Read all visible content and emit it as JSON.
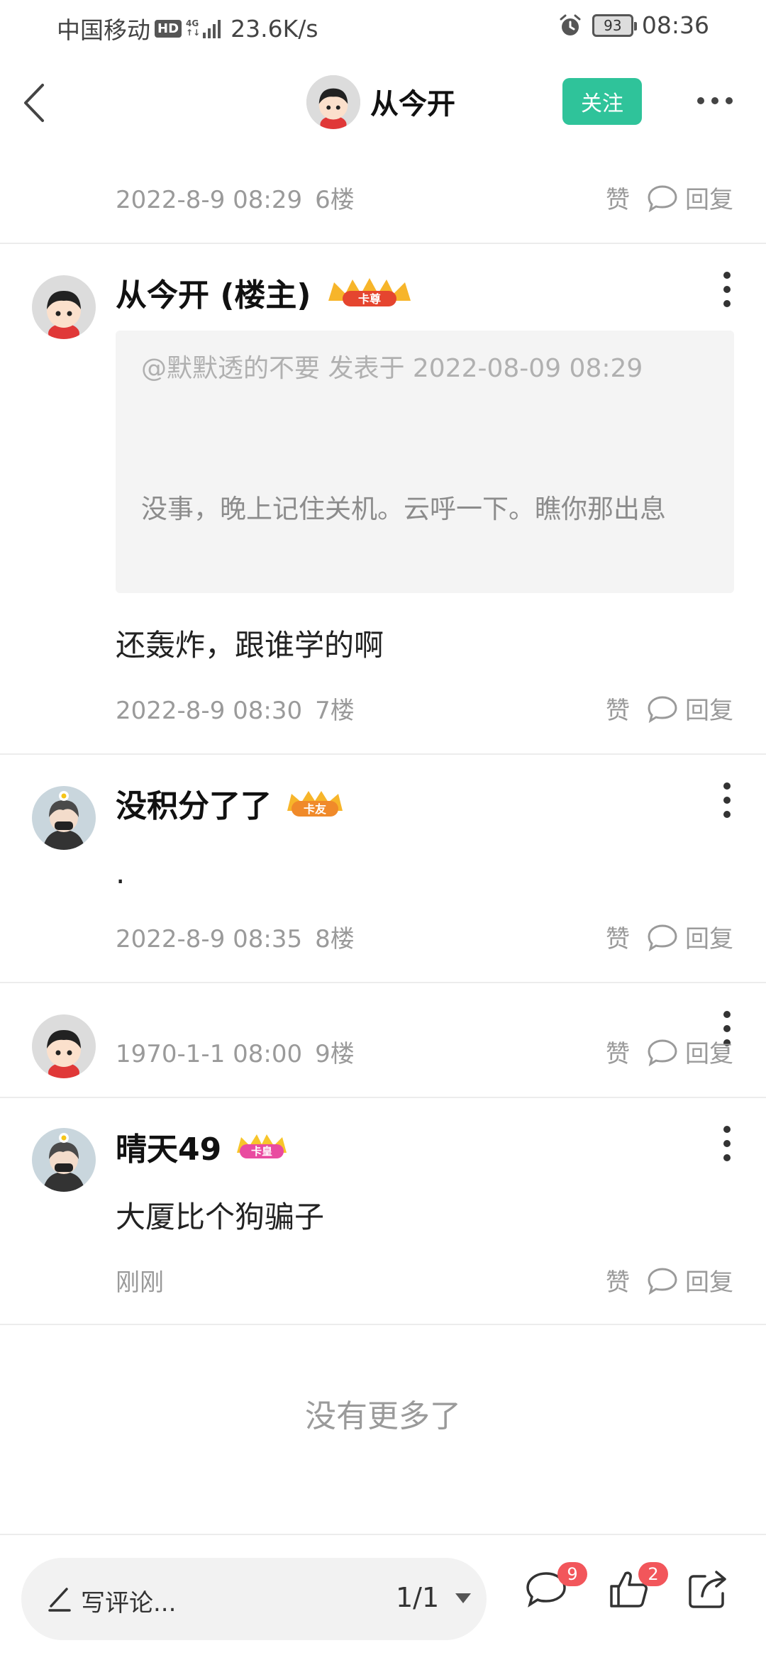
{
  "status_bar": {
    "carrier": "中国移动",
    "hd": "HD",
    "network_top": "4G",
    "network_bottom": "↑↓",
    "speed": "23.6K/s",
    "battery": "93",
    "time": "08:36"
  },
  "header": {
    "title": "从今开",
    "follow_label": "关注"
  },
  "posts": [
    {
      "time": "2022-8-9 08:29",
      "floor": "6楼",
      "like": "赞",
      "reply": "回复"
    },
    {
      "username": "从今开 (楼主)",
      "badge": "卡尊",
      "quote_head": "@默默透的不要 发表于 2022-08-09 08:29",
      "quote_body": "没事，晚上记住关机。云呼一下。瞧你那出息",
      "content": "还轰炸，跟谁学的啊",
      "time": "2022-8-9 08:30",
      "floor": "7楼",
      "like": "赞",
      "reply": "回复"
    },
    {
      "username": "没积分了了",
      "badge": "卡友",
      "content": ".",
      "time": "2022-8-9 08:35",
      "floor": "8楼",
      "like": "赞",
      "reply": "回复"
    },
    {
      "time": "1970-1-1 08:00",
      "floor": "9楼",
      "like": "赞",
      "reply": "回复"
    },
    {
      "username": "晴天49",
      "badge": "卡皇",
      "content": "大厦比个狗骗子",
      "time": "刚刚",
      "like": "赞",
      "reply": "回复"
    }
  ],
  "no_more": "没有更多了",
  "bottom_bar": {
    "comment_placeholder": "写评论...",
    "page_indicator": "1/1",
    "comments_count": "9",
    "likes_count": "2"
  },
  "colors": {
    "accent": "#2fc39a",
    "badge_red": "#f2565b",
    "meta_gray": "#9a9a9a"
  }
}
